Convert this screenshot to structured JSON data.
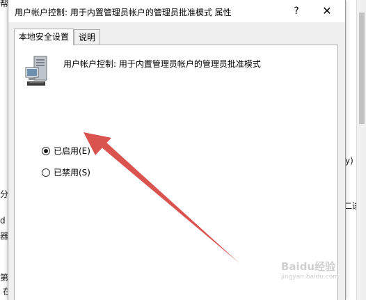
{
  "background": {
    "fragments": [
      "帮",
      "y)",
      "分配",
      "二进制",
      "d",
      "器",
      "第",
      "在"
    ]
  },
  "dialog": {
    "title": "用户帐户控制: 用于内置管理员帐户的管理员批准模式 属性",
    "help_glyph": "?",
    "close_glyph": "✕",
    "tabs": [
      {
        "label": "本地安全设置",
        "active": true
      },
      {
        "label": "说明",
        "active": false
      }
    ],
    "policy_icon": "server-computer-icon",
    "policy_name": "用户帐户控制: 用于内置管理员帐户的管理员批准模式",
    "options": [
      {
        "label": "已启用(E)",
        "checked": true
      },
      {
        "label": "已禁用(S)",
        "checked": false
      }
    ]
  },
  "annotation": {
    "arrow_color": "#d9534f",
    "watermark_lines": [
      "Baidu经验",
      "jingyan.baidu.com"
    ]
  }
}
